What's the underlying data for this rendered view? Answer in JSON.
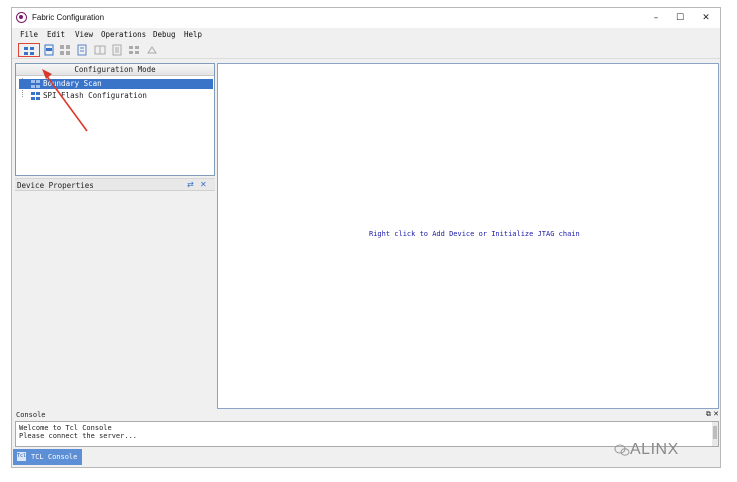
{
  "window": {
    "title": "Fabric Configuration",
    "minimize": "–",
    "maximize": "☐",
    "close": "✕"
  },
  "menu": {
    "items": [
      {
        "label": "File"
      },
      {
        "label": "Edit"
      },
      {
        "label": "View"
      },
      {
        "label": "Operations"
      },
      {
        "label": "Debug"
      },
      {
        "label": "Help"
      }
    ]
  },
  "toolbar": {
    "icons": [
      "boundary-scan-icon",
      "spi-flash-icon",
      "grid-icon",
      "chip-icon",
      "device-icon",
      "program-icon",
      "verify-icon",
      "erase-icon"
    ]
  },
  "config_panel": {
    "header": "Configuration Mode",
    "items": [
      {
        "label": "Boundary Scan",
        "selected": true
      },
      {
        "label": "SPI Flash Configuration",
        "selected": false
      }
    ]
  },
  "props_panel": {
    "title": "Device Properties"
  },
  "main": {
    "message": "Right click to Add Device or Initialize JTAG chain"
  },
  "console": {
    "label": "Console",
    "lines": [
      "Welcome to Tcl Console",
      "Please connect the server..."
    ],
    "tab_label": "TCL Console",
    "tab_icon_text": "Tcl"
  },
  "watermark": {
    "text": "ALINX"
  },
  "colors": {
    "selection": "#3a74c9",
    "message": "#1a1aa8",
    "arrow": "#d9392c",
    "tab": "#5d8fd6"
  }
}
